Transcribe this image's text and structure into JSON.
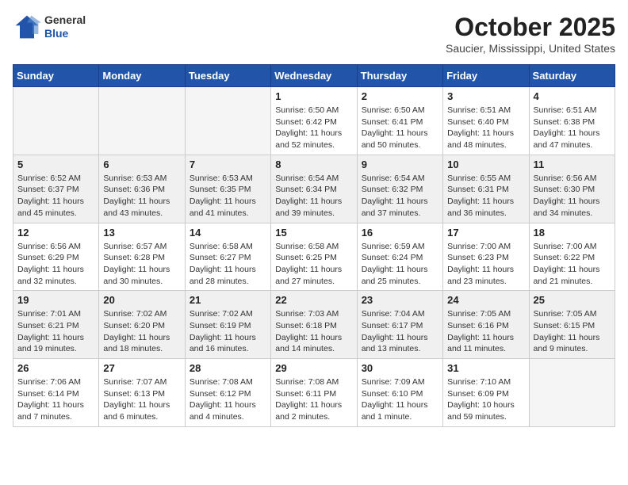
{
  "header": {
    "logo": {
      "general": "General",
      "blue": "Blue"
    },
    "title": "October 2025",
    "location": "Saucier, Mississippi, United States"
  },
  "days_of_week": [
    "Sunday",
    "Monday",
    "Tuesday",
    "Wednesday",
    "Thursday",
    "Friday",
    "Saturday"
  ],
  "weeks": [
    [
      {
        "day": "",
        "info": ""
      },
      {
        "day": "",
        "info": ""
      },
      {
        "day": "",
        "info": ""
      },
      {
        "day": "1",
        "info": "Sunrise: 6:50 AM\nSunset: 6:42 PM\nDaylight: 11 hours\nand 52 minutes."
      },
      {
        "day": "2",
        "info": "Sunrise: 6:50 AM\nSunset: 6:41 PM\nDaylight: 11 hours\nand 50 minutes."
      },
      {
        "day": "3",
        "info": "Sunrise: 6:51 AM\nSunset: 6:40 PM\nDaylight: 11 hours\nand 48 minutes."
      },
      {
        "day": "4",
        "info": "Sunrise: 6:51 AM\nSunset: 6:38 PM\nDaylight: 11 hours\nand 47 minutes."
      }
    ],
    [
      {
        "day": "5",
        "info": "Sunrise: 6:52 AM\nSunset: 6:37 PM\nDaylight: 11 hours\nand 45 minutes."
      },
      {
        "day": "6",
        "info": "Sunrise: 6:53 AM\nSunset: 6:36 PM\nDaylight: 11 hours\nand 43 minutes."
      },
      {
        "day": "7",
        "info": "Sunrise: 6:53 AM\nSunset: 6:35 PM\nDaylight: 11 hours\nand 41 minutes."
      },
      {
        "day": "8",
        "info": "Sunrise: 6:54 AM\nSunset: 6:34 PM\nDaylight: 11 hours\nand 39 minutes."
      },
      {
        "day": "9",
        "info": "Sunrise: 6:54 AM\nSunset: 6:32 PM\nDaylight: 11 hours\nand 37 minutes."
      },
      {
        "day": "10",
        "info": "Sunrise: 6:55 AM\nSunset: 6:31 PM\nDaylight: 11 hours\nand 36 minutes."
      },
      {
        "day": "11",
        "info": "Sunrise: 6:56 AM\nSunset: 6:30 PM\nDaylight: 11 hours\nand 34 minutes."
      }
    ],
    [
      {
        "day": "12",
        "info": "Sunrise: 6:56 AM\nSunset: 6:29 PM\nDaylight: 11 hours\nand 32 minutes."
      },
      {
        "day": "13",
        "info": "Sunrise: 6:57 AM\nSunset: 6:28 PM\nDaylight: 11 hours\nand 30 minutes."
      },
      {
        "day": "14",
        "info": "Sunrise: 6:58 AM\nSunset: 6:27 PM\nDaylight: 11 hours\nand 28 minutes."
      },
      {
        "day": "15",
        "info": "Sunrise: 6:58 AM\nSunset: 6:25 PM\nDaylight: 11 hours\nand 27 minutes."
      },
      {
        "day": "16",
        "info": "Sunrise: 6:59 AM\nSunset: 6:24 PM\nDaylight: 11 hours\nand 25 minutes."
      },
      {
        "day": "17",
        "info": "Sunrise: 7:00 AM\nSunset: 6:23 PM\nDaylight: 11 hours\nand 23 minutes."
      },
      {
        "day": "18",
        "info": "Sunrise: 7:00 AM\nSunset: 6:22 PM\nDaylight: 11 hours\nand 21 minutes."
      }
    ],
    [
      {
        "day": "19",
        "info": "Sunrise: 7:01 AM\nSunset: 6:21 PM\nDaylight: 11 hours\nand 19 minutes."
      },
      {
        "day": "20",
        "info": "Sunrise: 7:02 AM\nSunset: 6:20 PM\nDaylight: 11 hours\nand 18 minutes."
      },
      {
        "day": "21",
        "info": "Sunrise: 7:02 AM\nSunset: 6:19 PM\nDaylight: 11 hours\nand 16 minutes."
      },
      {
        "day": "22",
        "info": "Sunrise: 7:03 AM\nSunset: 6:18 PM\nDaylight: 11 hours\nand 14 minutes."
      },
      {
        "day": "23",
        "info": "Sunrise: 7:04 AM\nSunset: 6:17 PM\nDaylight: 11 hours\nand 13 minutes."
      },
      {
        "day": "24",
        "info": "Sunrise: 7:05 AM\nSunset: 6:16 PM\nDaylight: 11 hours\nand 11 minutes."
      },
      {
        "day": "25",
        "info": "Sunrise: 7:05 AM\nSunset: 6:15 PM\nDaylight: 11 hours\nand 9 minutes."
      }
    ],
    [
      {
        "day": "26",
        "info": "Sunrise: 7:06 AM\nSunset: 6:14 PM\nDaylight: 11 hours\nand 7 minutes."
      },
      {
        "day": "27",
        "info": "Sunrise: 7:07 AM\nSunset: 6:13 PM\nDaylight: 11 hours\nand 6 minutes."
      },
      {
        "day": "28",
        "info": "Sunrise: 7:08 AM\nSunset: 6:12 PM\nDaylight: 11 hours\nand 4 minutes."
      },
      {
        "day": "29",
        "info": "Sunrise: 7:08 AM\nSunset: 6:11 PM\nDaylight: 11 hours\nand 2 minutes."
      },
      {
        "day": "30",
        "info": "Sunrise: 7:09 AM\nSunset: 6:10 PM\nDaylight: 11 hours\nand 1 minute."
      },
      {
        "day": "31",
        "info": "Sunrise: 7:10 AM\nSunset: 6:09 PM\nDaylight: 10 hours\nand 59 minutes."
      },
      {
        "day": "",
        "info": ""
      }
    ]
  ]
}
